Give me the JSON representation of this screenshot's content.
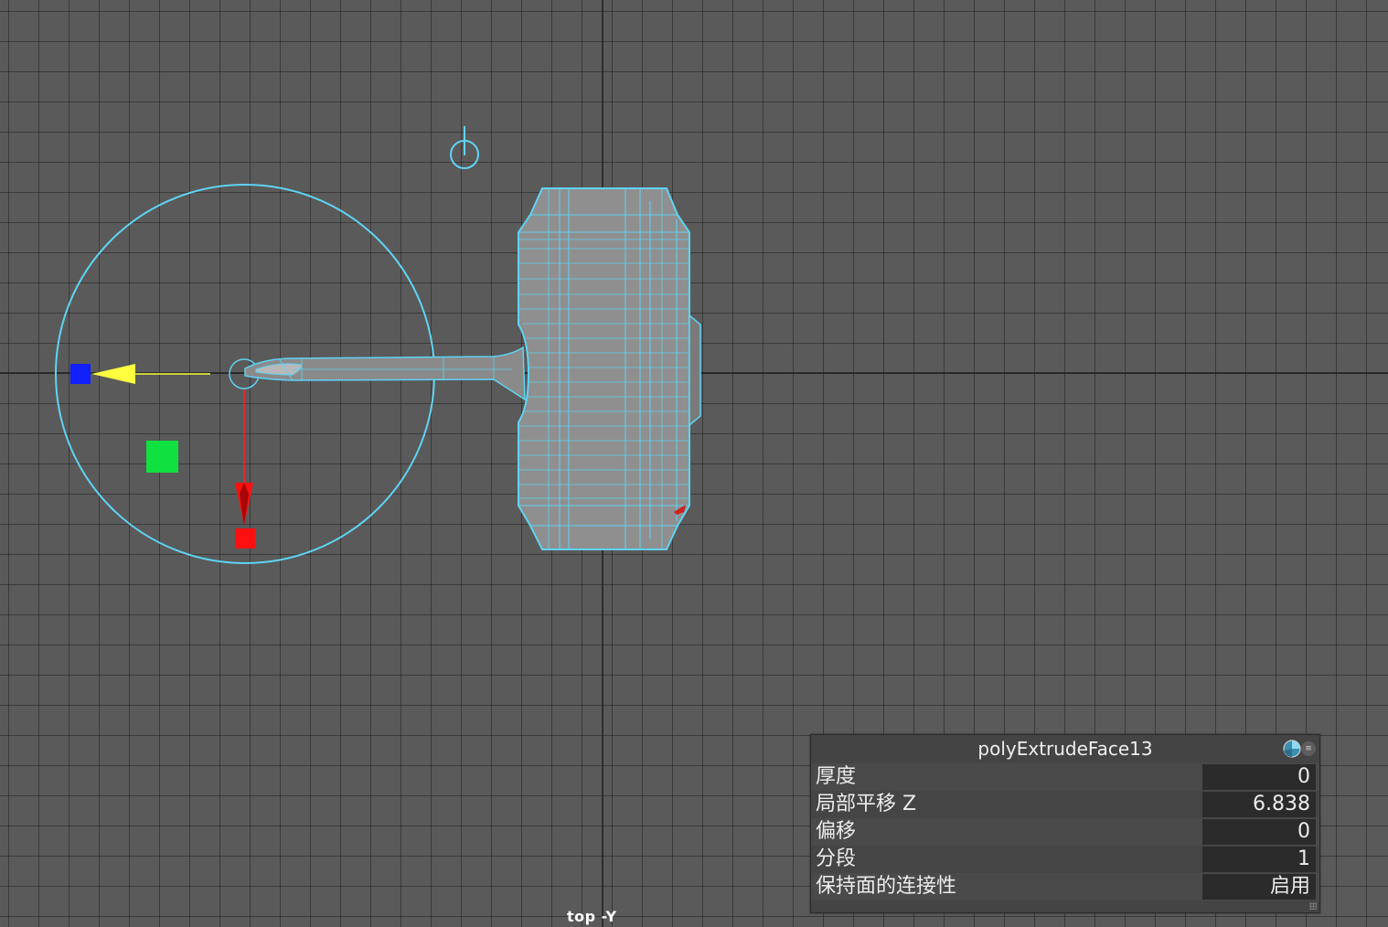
{
  "viewport": {
    "camera_label": "top -Y",
    "grid_color": "#1e1e1e",
    "background_color": "#5a5a5a",
    "wireframe_color": "#5fd3f3"
  },
  "manipulator": {
    "ring_color": "#5fd3f3",
    "x_axis_color": "#ff2020",
    "z_axis_color": "#ffff40",
    "handle_blue": "#1020ff",
    "handle_green": "#10e040",
    "handle_red": "#ff1010",
    "icons": [
      "rotate-ring-icon",
      "move-arrow-icon",
      "scale-handle-icon",
      "pivot-icon"
    ]
  },
  "tool_panel": {
    "title": "polyExtrudeFace13",
    "icons": [
      "pie-icon",
      "menu-icon"
    ],
    "attributes": [
      {
        "label": "厚度",
        "value": "0"
      },
      {
        "label": "局部平移 Z",
        "value": "6.838"
      },
      {
        "label": "偏移",
        "value": "0"
      },
      {
        "label": "分段",
        "value": "1"
      },
      {
        "label": "保持面的连接性",
        "value": "启用"
      }
    ]
  }
}
